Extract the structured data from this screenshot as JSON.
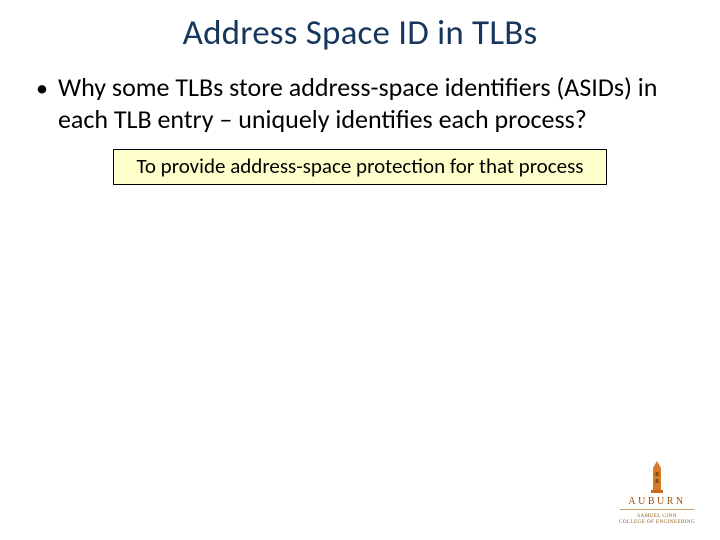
{
  "slide": {
    "title": "Address Space ID in TLBs",
    "bullet1": {
      "marker": "•",
      "line": "Why some TLBs store address-space identifiers (ASIDs) in each TLB entry – uniquely identifies each process?"
    },
    "answer": "To provide address-space protection for that process"
  },
  "logo": {
    "university": "AUBURN",
    "sub1": "SAMUEL GINN",
    "sub2": "COLLEGE OF ENGINEERING"
  }
}
